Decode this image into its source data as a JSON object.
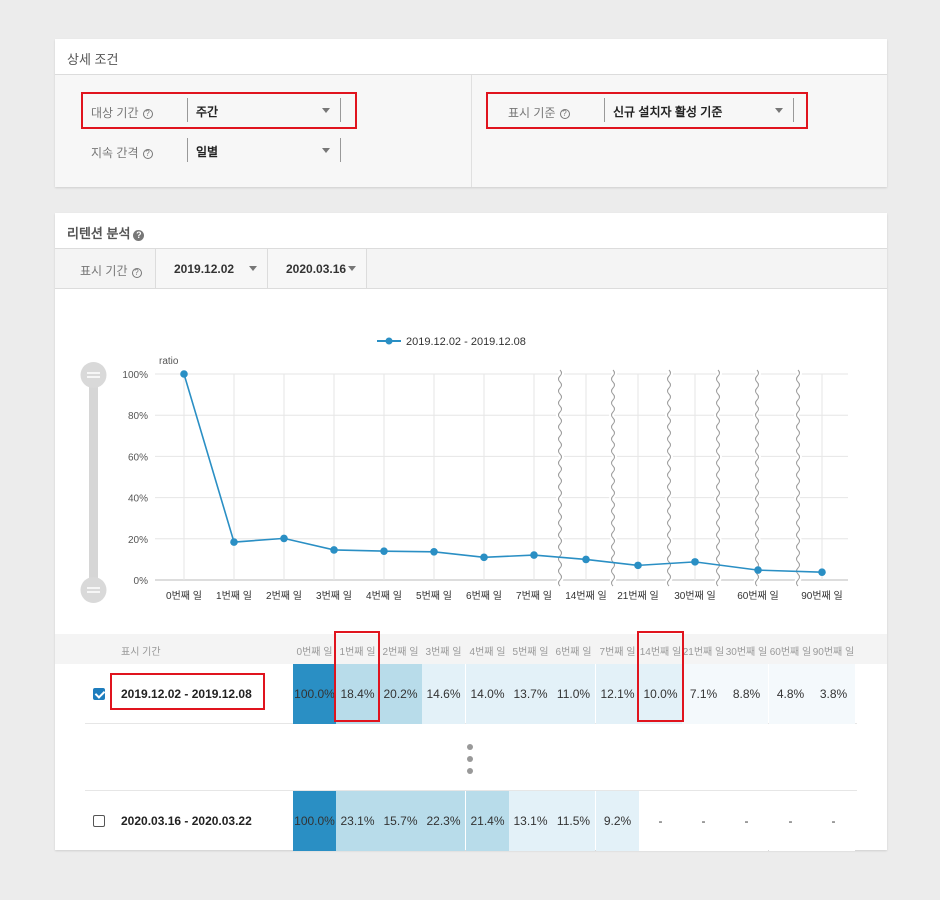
{
  "conditions": {
    "title": "상세 조건",
    "target_period": {
      "label": "대상 기간",
      "value": "주간"
    },
    "interval": {
      "label": "지속 간격",
      "value": "일별"
    },
    "display_basis": {
      "label": "표시 기준",
      "value": "신규 설치자 활성 기준"
    }
  },
  "retention": {
    "title": "리텐션 분석",
    "period_label": "표시 기간",
    "start_date": "2019.12.02",
    "end_date": "2020.03.16"
  },
  "chart_data": {
    "type": "line",
    "legend": "2019.12.02 - 2019.12.08",
    "ylabel": "ratio",
    "yticks": [
      "0%",
      "20%",
      "40%",
      "60%",
      "80%",
      "100%"
    ],
    "ylim": [
      0,
      100
    ],
    "categories": [
      "0번째 일",
      "1번째 일",
      "2번째 일",
      "3번째 일",
      "4번째 일",
      "5번째 일",
      "6번째 일",
      "7번째 일",
      "14번째 일",
      "21번째 일",
      "30번째 일",
      "60번째 일",
      "90번째 일"
    ],
    "series": [
      {
        "name": "2019.12.02 - 2019.12.08",
        "values": [
          100,
          18.4,
          20.2,
          14.6,
          14.0,
          13.7,
          11.0,
          12.1,
          10.0,
          7.1,
          8.8,
          4.8,
          3.8
        ]
      }
    ],
    "color": "#2a8fc4"
  },
  "table": {
    "period_header": "표시 기간",
    "columns": [
      "0번째 일",
      "1번째 일",
      "2번째 일",
      "3번째 일",
      "4번째 일",
      "5번째 일",
      "6번째 일",
      "7번째 일",
      "14번째 일",
      "21번째 일",
      "30번째 일",
      "60번째 일",
      "90번째 일"
    ],
    "rows": [
      {
        "period": "2019.12.02 - 2019.12.08",
        "checked": true,
        "values": [
          "100.0%",
          "18.4%",
          "20.2%",
          "14.6%",
          "14.0%",
          "13.7%",
          "11.0%",
          "12.1%",
          "10.0%",
          "7.1%",
          "8.8%",
          "4.8%",
          "3.8%"
        ]
      },
      {
        "period": "2020.03.16 - 2020.03.22",
        "checked": false,
        "values": [
          "100.0%",
          "23.1%",
          "15.7%",
          "22.3%",
          "21.4%",
          "13.1%",
          "11.5%",
          "9.2%",
          "-",
          "-",
          "-",
          "-",
          "-"
        ]
      }
    ]
  },
  "colors": {
    "highlight_red": "#e0141e",
    "accent_blue": "#1e7dbd",
    "heat_max": "#2a8fc4",
    "heat_high": "#b8dcea",
    "heat_low": "#e3f1f8"
  }
}
